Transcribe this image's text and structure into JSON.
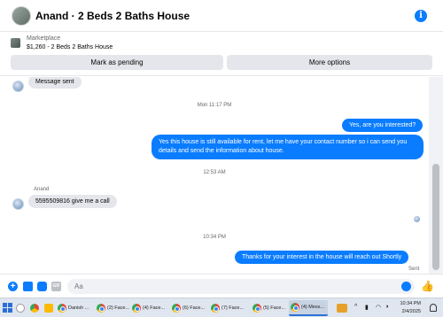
{
  "header": {
    "title": "Anand · 2 Beds 2 Baths House",
    "info_icon": "info-icon",
    "accent_color": "#0a7cff"
  },
  "marketplace": {
    "label": "Marketplace",
    "price_title": "$1,260 - 2 Beds 2 Baths House",
    "pending_label": "Mark as pending",
    "more_label": "More options"
  },
  "messages": {
    "first_incoming": "Message sent",
    "ts1": "Mon 11:17 PM",
    "out1": "Yes, are you interested?",
    "out2": "Yes this house is still available for rent, let me have your contact number so i can send you details and send the information about house.",
    "ts2": "12:53 AM",
    "sender": "Anand",
    "in2": "5595509816 give me a call",
    "ts3": "10:34 PM",
    "out3": "Thanks for your interest in the house will reach out Shortly",
    "status": "Sent"
  },
  "composer": {
    "placeholder": "Aa",
    "icons": [
      "plus-icon",
      "photo-icon",
      "sticker-icon",
      "gif-icon",
      "emoji-icon",
      "like-icon"
    ],
    "gif_label": "GIF"
  },
  "taskbar": {
    "items": [
      {
        "label": "Danish ..."
      },
      {
        "label": "(2) Face..."
      },
      {
        "label": "(4) Face..."
      },
      {
        "label": "(6) Face..."
      },
      {
        "label": "(7) Face..."
      },
      {
        "label": "(5) Face..."
      },
      {
        "label": "(4) Mess..."
      }
    ],
    "time": "10:34 PM",
    "date": "2/4/2025"
  }
}
